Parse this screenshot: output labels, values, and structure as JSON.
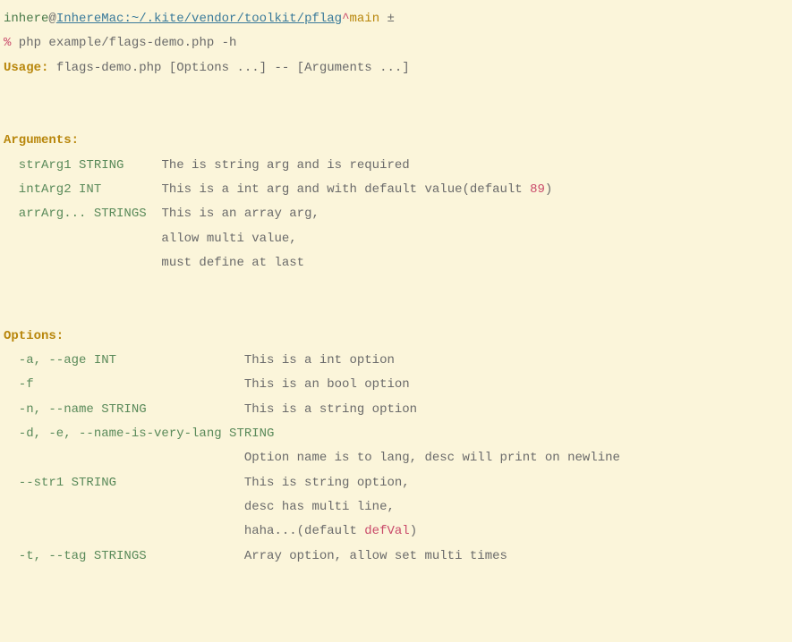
{
  "prompt": {
    "user": "inhere",
    "at": "@",
    "hostPath": "InhereMac:~/.kite/vendor/toolkit/pflag",
    "caret": "^",
    "branch": "main",
    "dirty": " ±",
    "symbol": "%",
    "command": " php example/flags-demo.php -h"
  },
  "usage": {
    "label": "Usage:",
    "text": " flags-demo.php [Options ...] -- [Arguments ...]"
  },
  "argsHeader": "Arguments:",
  "args": {
    "a1name": "  strArg1 STRING     ",
    "a1desc": "The is string arg and is required",
    "a2name": "  intArg2 INT        ",
    "a2desc": "This is a int arg and with default value(default ",
    "a2val": "89",
    "a2close": ")",
    "a3name": "  arrArg... STRINGS  ",
    "a3desc": "This is an array arg,",
    "a3l2": "                     allow multi value,",
    "a3l3": "                     must define at last"
  },
  "optsHeader": "Options:",
  "opts": {
    "o1name": "  -a, --age INT                 ",
    "o1desc": "This is a int option",
    "o2name": "  -f                            ",
    "o2desc": "This is an bool option",
    "o3name": "  -n, --name STRING             ",
    "o3desc": "This is a string option",
    "o4name": "  -d, -e, --name-is-very-lang STRING",
    "o4desc": "                                Option name is to lang, desc will print on newline",
    "o5name": "  --str1 STRING                 ",
    "o5desc": "This is string option,",
    "o5l2": "                                desc has multi line,",
    "o5l3a": "                                haha...(default ",
    "o5val": "defVal",
    "o5l3b": ")",
    "o6name": "  -t, --tag STRINGS             ",
    "o6desc": "Array option, allow set multi times"
  }
}
